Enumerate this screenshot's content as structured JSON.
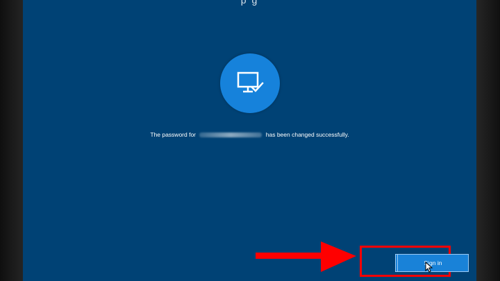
{
  "screen": {
    "title_partial": "p                                 g",
    "message_prefix": "The password for",
    "message_account_hidden": "",
    "message_suffix": "has been changed successfully.",
    "sign_in_label": "Sign in"
  },
  "icons": {
    "status": "monitor-check-icon",
    "cursor": "mouse-pointer-icon",
    "arrow": "red-arrow-icon"
  },
  "colors": {
    "background": "#004275",
    "icon_circle": "#1682db",
    "button": "#1982d8",
    "highlight": "#ff0000"
  }
}
